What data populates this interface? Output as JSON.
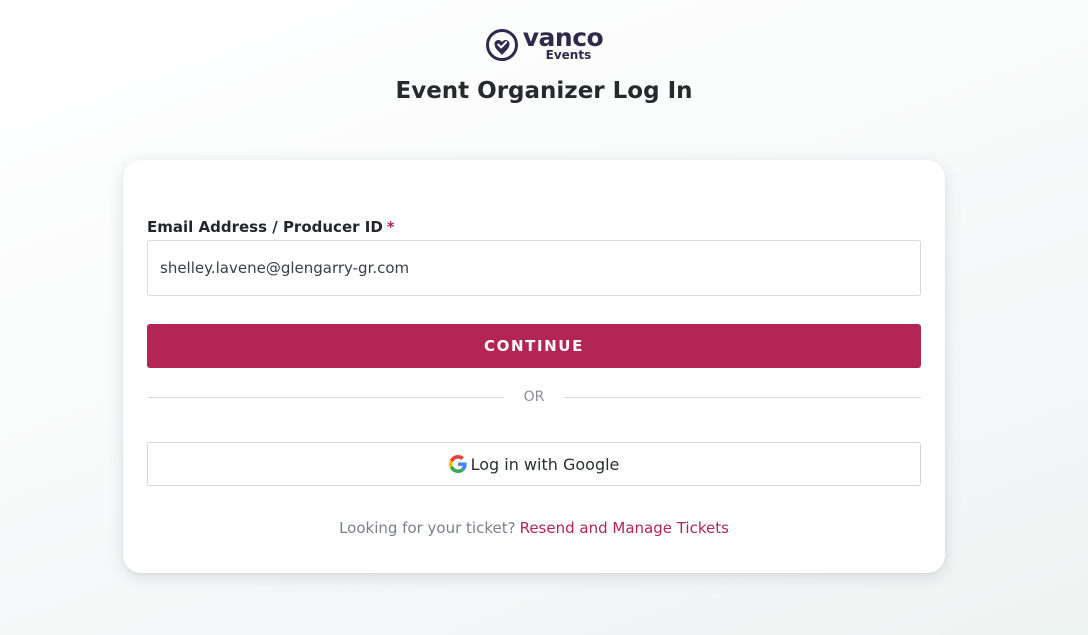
{
  "brand": {
    "name": "vanco",
    "sub": "Events",
    "color": "#2f2a4d",
    "icon": "heart-check-logo-icon"
  },
  "page": {
    "title": "Event Organizer Log In"
  },
  "login_form": {
    "email_label": "Email Address / Producer ID",
    "required_marker": "*",
    "email_value": "shelley.lavene@glengarry-gr.com",
    "continue_label": "CONTINUE",
    "divider_text": "OR",
    "google_label": "Log in with Google",
    "google_icon": "google-g-icon",
    "ticket_prompt": "Looking for your ticket?",
    "ticket_link": "Resend and Manage Tickets"
  },
  "colors": {
    "accent": "#b22555",
    "text_dark": "#27292d",
    "muted": "#7a808a",
    "border": "#d6d8dc"
  }
}
